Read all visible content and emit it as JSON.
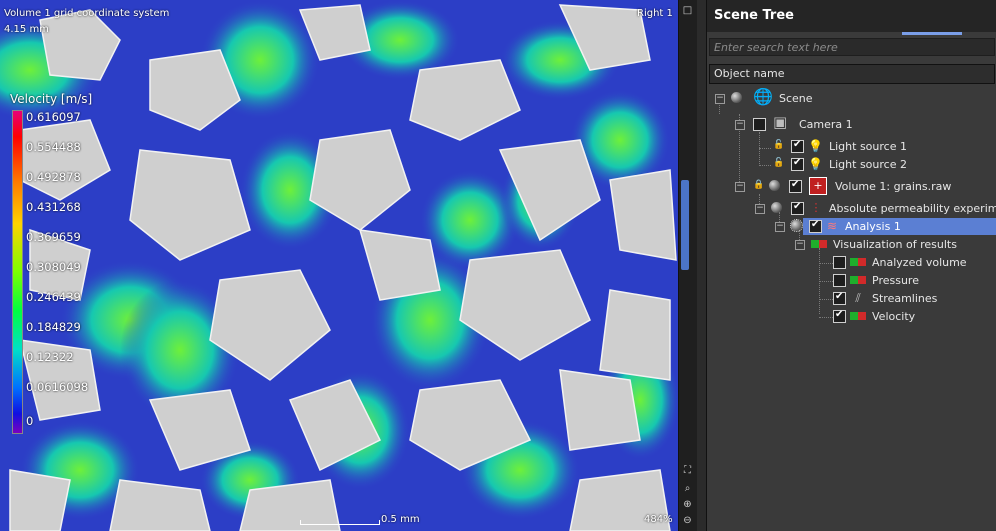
{
  "viewport": {
    "title": "Volume 1 grid coordinate system",
    "size_text": "4.15 mm",
    "view_name": "Right 1",
    "scale_text": "0.5 mm",
    "zoom_text": "484%"
  },
  "legend": {
    "title": "Velocity [m/s]",
    "ticks": [
      "0.616097",
      "0.554488",
      "0.492878",
      "0.431268",
      "0.369659",
      "0.308049",
      "0.246439",
      "0.184829",
      "0.12322",
      "0.0616098",
      "0"
    ]
  },
  "panel": {
    "title": "Scene Tree",
    "search_placeholder": "Enter search text here",
    "column_header": "Object name"
  },
  "tree": [
    {
      "label": "Scene",
      "icon": "globe-icon",
      "checked": null
    },
    {
      "label": "Camera 1",
      "icon": "camera-icon",
      "checked": false
    },
    {
      "label": "Light source 1",
      "icon": "lightbulb-icon",
      "checked": true
    },
    {
      "label": "Light source 2",
      "icon": "lightbulb-icon",
      "checked": true
    },
    {
      "label": "Volume 1: grains.raw",
      "icon": "volume-icon",
      "checked": true
    },
    {
      "label": "Absolute permeability experiment",
      "icon": "experiment-icon",
      "checked": true
    },
    {
      "label": "Analysis 1",
      "icon": "analysis-icon",
      "checked": true,
      "selected": true
    },
    {
      "label": "Visualization of results",
      "icon": "visualization-icon",
      "checked": null
    },
    {
      "label": "Analyzed volume",
      "icon": "result-icon",
      "checked": false
    },
    {
      "label": "Pressure",
      "icon": "result-icon",
      "checked": false
    },
    {
      "label": "Streamlines",
      "icon": "streamlines-icon",
      "checked": true
    },
    {
      "label": "Velocity",
      "icon": "result-icon",
      "checked": true
    }
  ],
  "colors": {
    "selection": "#5b7fd3",
    "panel_bg": "#3a3a3a",
    "grain": "#d0d0d0",
    "flow_low": "#2e3fc8",
    "flow_high": "#5ee03a"
  }
}
